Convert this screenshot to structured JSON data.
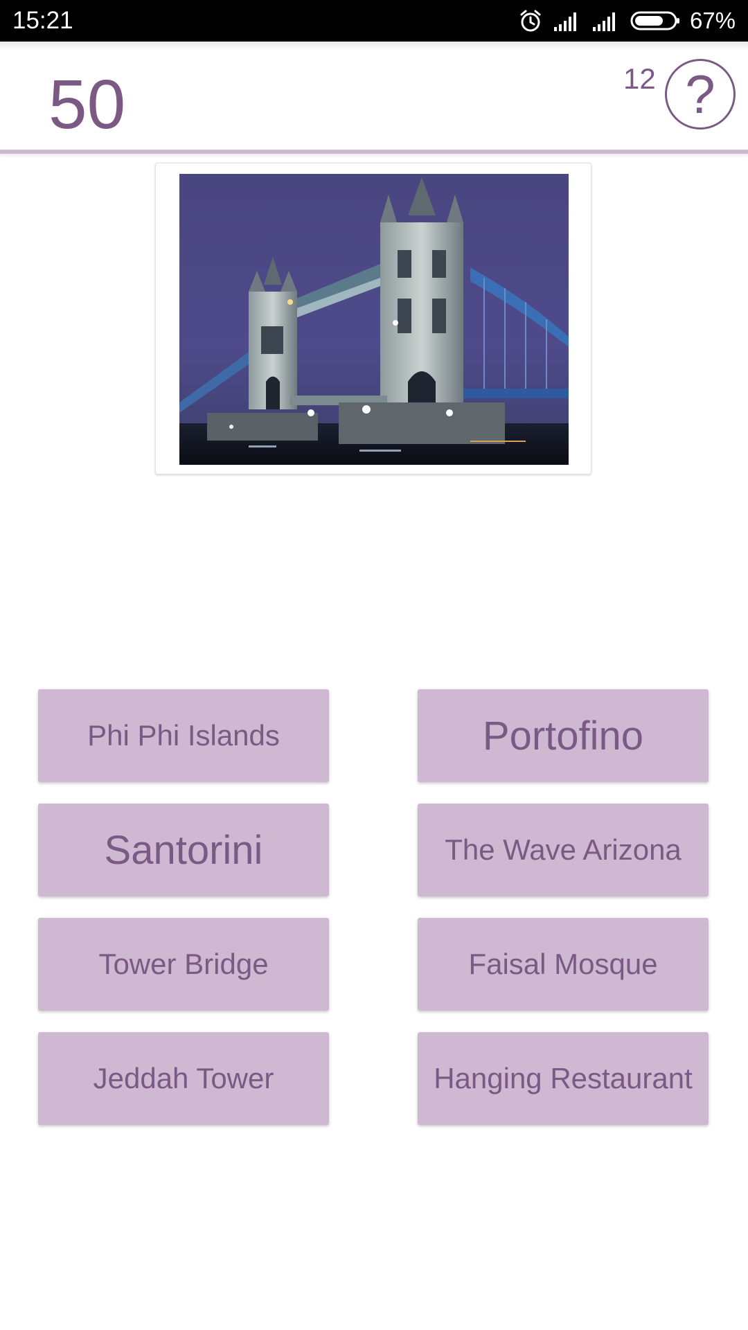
{
  "status_bar": {
    "time": "15:21",
    "battery_percent": "67%",
    "icons": [
      "alarm-icon",
      "signal-icon",
      "signal-icon",
      "battery-icon"
    ]
  },
  "header": {
    "score": "50",
    "hint_count": "12",
    "help_label": "?"
  },
  "question": {
    "image_icon": "tower-bridge-photo"
  },
  "answers": [
    {
      "label": "Phi Phi Islands"
    },
    {
      "label": "Portofino"
    },
    {
      "label": "Santorini"
    },
    {
      "label": "The Wave Arizona"
    },
    {
      "label": "Tower Bridge"
    },
    {
      "label": "Faisal Mosque"
    },
    {
      "label": "Jeddah Tower"
    },
    {
      "label": "Hanging Restaurant"
    }
  ],
  "colors": {
    "accent": "#7a5a84",
    "button_bg": "#cfb8d2",
    "divider": "#cdb8cf"
  }
}
